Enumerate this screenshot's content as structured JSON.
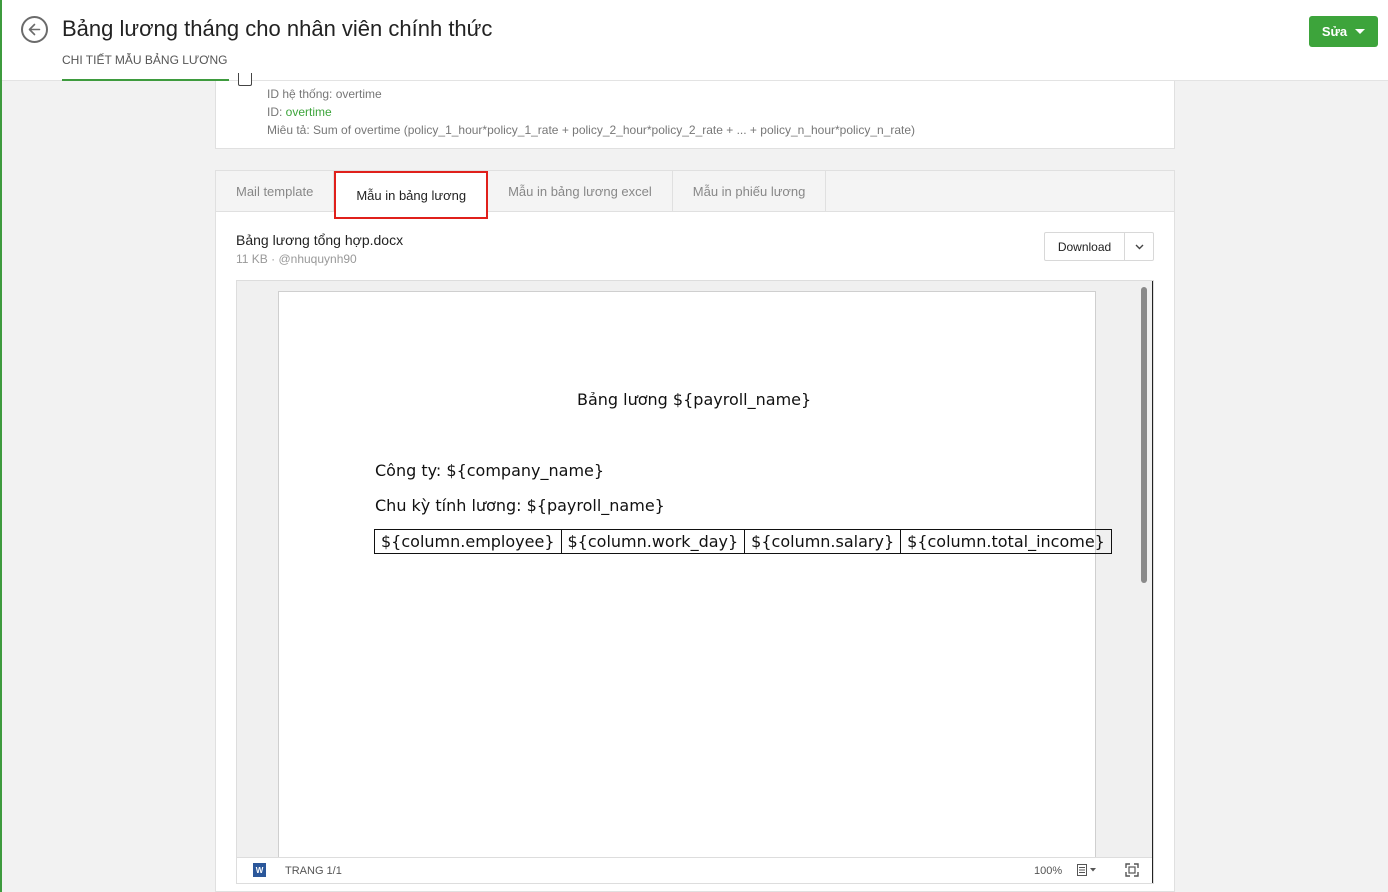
{
  "header": {
    "title": "Bảng lương tháng cho nhân viên chính thức",
    "subnav_label": "CHI TIẾT MẪU BẢNG LƯƠNG",
    "edit_button": "Sửa"
  },
  "info": {
    "system_id_label": "ID hệ thống: overtime",
    "id_label": "ID: ",
    "id_value": "overtime",
    "description": "Miêu tả: Sum of overtime (policy_1_hour*policy_1_rate + policy_2_hour*policy_2_rate + ... + policy_n_hour*policy_n_rate)"
  },
  "tabs": [
    {
      "label": "Mail template",
      "active": false
    },
    {
      "label": "Mẫu in bảng lương",
      "active": true
    },
    {
      "label": "Mẫu in bảng lương excel",
      "active": false
    },
    {
      "label": "Mẫu in phiếu lương",
      "active": false
    }
  ],
  "file": {
    "name": "Bảng lương tổng hợp.docx",
    "meta": "11 KB · @nhuquynh90",
    "download_label": "Download"
  },
  "document": {
    "title": "Bảng lương ${payroll_name}",
    "company_line": "Công ty: ${company_name}",
    "period_line": "Chu kỳ tính lương: ${payroll_name}",
    "table_columns": [
      "${column.employee}",
      "${column.work_day}",
      "${column.salary}",
      "${column.total_income}"
    ]
  },
  "viewer": {
    "page_indicator": "TRANG 1/1",
    "zoom": "100%",
    "word_icon_letter": "W"
  },
  "colors": {
    "accent_green": "#3da43b",
    "highlight_red": "#e0201b",
    "word_blue": "#2b579a"
  }
}
